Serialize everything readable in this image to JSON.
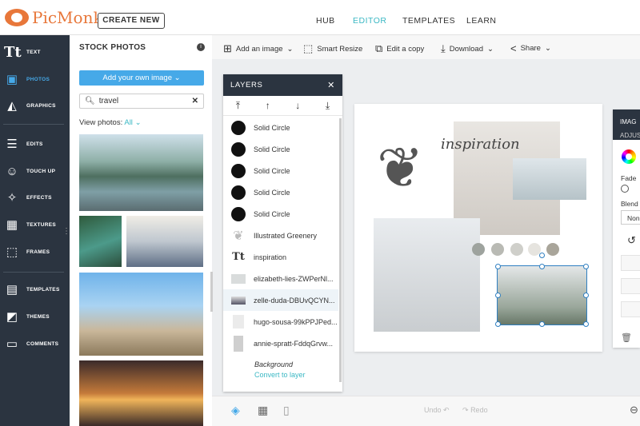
{
  "header": {
    "logo": "PicMonkey",
    "create_new": "CREATE NEW",
    "nav": [
      "HUB",
      "EDITOR",
      "TEMPLATES",
      "LEARN"
    ],
    "active_nav": "EDITOR",
    "accent": "#3bb8c4"
  },
  "sidebar": {
    "items": [
      {
        "label": "TEXT",
        "icon": "text-icon"
      },
      {
        "label": "PHOTOS",
        "icon": "photos-icon"
      },
      {
        "label": "GRAPHICS",
        "icon": "graphics-icon"
      },
      {
        "label": "EDITS",
        "icon": "sliders-icon"
      },
      {
        "label": "TOUCH UP",
        "icon": "face-icon"
      },
      {
        "label": "EFFECTS",
        "icon": "wand-icon"
      },
      {
        "label": "TEXTURES",
        "icon": "texture-icon"
      },
      {
        "label": "FRAMES",
        "icon": "frame-icon"
      },
      {
        "label": "TEMPLATES",
        "icon": "templates-icon"
      },
      {
        "label": "THEMES",
        "icon": "themes-icon"
      },
      {
        "label": "COMMENTS",
        "icon": "comments-icon"
      }
    ],
    "active": "PHOTOS"
  },
  "stock": {
    "title": "STOCK PHOTOS",
    "add_own": "Add your own image",
    "search_value": "travel",
    "view_label": "View photos:",
    "view_value": "All"
  },
  "toolbar": {
    "add_image": "Add an image",
    "smart_resize": "Smart Resize",
    "edit_copy": "Edit a copy",
    "download": "Download",
    "share": "Share"
  },
  "layers": {
    "title": "LAYERS",
    "items": [
      "Solid Circle",
      "Solid Circle",
      "Solid Circle",
      "Solid Circle",
      "Solid Circle",
      "Illustrated Greenery",
      "inspiration",
      "elizabeth-lies-ZWPerNl...",
      "zelle-duda-DBUvQCYN...",
      "hugo-sousa-99kPPJPed...",
      "annie-spratt-FddqGrvw..."
    ],
    "background": "Background",
    "convert": "Convert to layer"
  },
  "canvas": {
    "script_text": "inspiration",
    "swatches": [
      "#9ea39e",
      "#b9bab4",
      "#cfcfca",
      "#e6e4df",
      "#a9a59a"
    ]
  },
  "right_panel": {
    "title": "IMAG",
    "tab": "ADJUS",
    "fade": "Fade",
    "blend": "Blend",
    "blend_value": "Non"
  },
  "bottom": {
    "undo": "Undo",
    "redo": "Redo"
  }
}
